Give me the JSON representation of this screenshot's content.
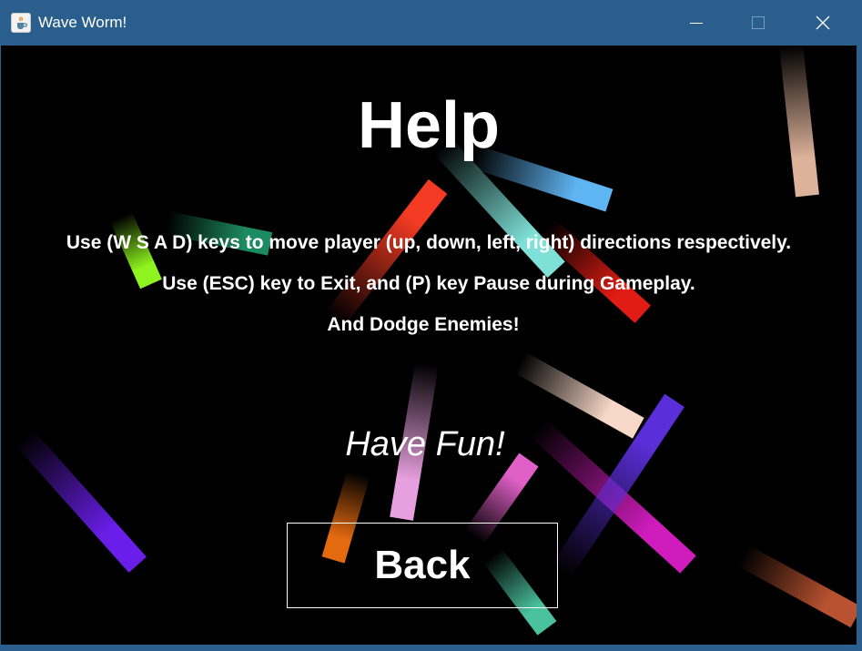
{
  "window": {
    "title": "Wave Worm!",
    "icon": "java-cup-icon",
    "controls": {
      "minimize": "minimize-icon",
      "maximize": "maximize-icon",
      "close": "close-icon"
    }
  },
  "help": {
    "heading": "Help",
    "lines": [
      "Use (W S A D) keys to move player (up, down, left, right) directions respectively.",
      "Use (ESC) key to Exit, and (P) key Pause during Gameplay.",
      "And Dodge Enemies!"
    ],
    "fun": "Have Fun!",
    "back_label": "Back"
  },
  "colors": {
    "titlebar": "#2a5e8c",
    "background": "#000000",
    "text": "#ffffff",
    "worms": [
      "#8ef31e",
      "#1c8a62",
      "#f43a22",
      "#7ee0d6",
      "#5fb4f2",
      "#e01c14",
      "#ddb29a",
      "#6a1eea",
      "#e7a0df",
      "#f8d8c8",
      "#d01cbc",
      "#e060c8",
      "#5a2ed8",
      "#e46a10",
      "#4ac29c",
      "#b85230"
    ]
  }
}
